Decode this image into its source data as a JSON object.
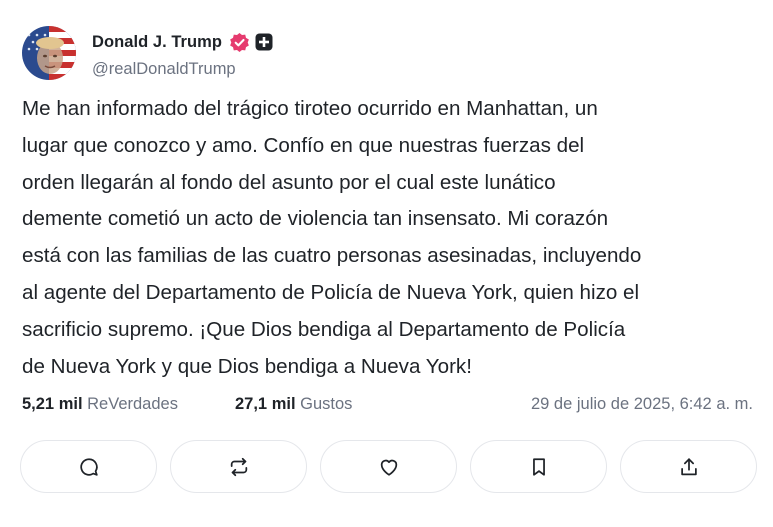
{
  "author": {
    "display_name": "Donald J. Trump",
    "handle": "@realDonaldTrump"
  },
  "post": {
    "text": "Me han informado del trágico tiroteo ocurrido en Manhattan, un\nlugar que conozco y amo. Confío en que nuestras fuerzas del\norden llegarán al fondo del asunto por el cual este lunático\ndemente cometió un acto de violencia tan insensato. Mi corazón\nestá con las familias de las cuatro personas asesinadas, incluyendo\nal agente del Departamento de Policía de Nueva York, quien hizo el\nsacrificio supremo. ¡Que Dios bendiga al Departamento de Policía\nde Nueva York y que Dios bendiga a Nueva York!"
  },
  "stats": {
    "retruths_count": "5,21 mil",
    "retruths_label": "ReVerdades",
    "likes_count": "27,1 mil",
    "likes_label": "Gustos",
    "timestamp": "29 de julio de 2025, 6:42 a. m."
  },
  "actions": [
    {
      "icon": "reply-icon"
    },
    {
      "icon": "retruth-icon"
    },
    {
      "icon": "heart-icon"
    },
    {
      "icon": "bookmark-icon"
    },
    {
      "icon": "share-icon"
    }
  ],
  "colors": {
    "text": "#1f2328",
    "muted": "#6b7280",
    "verified_badge": "#e63b6f",
    "border": "#e5e7eb"
  }
}
